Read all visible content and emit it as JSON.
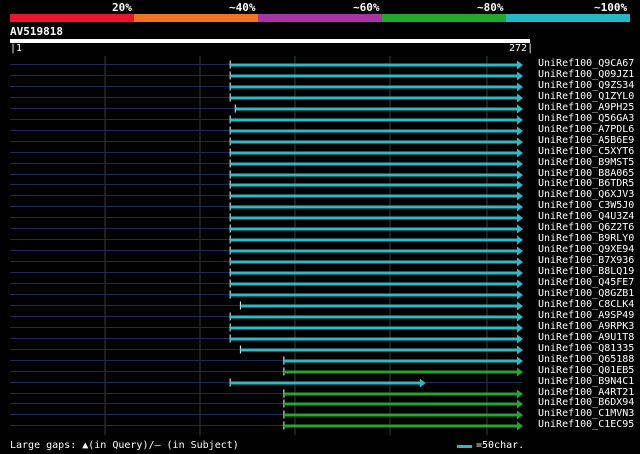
{
  "percent_labels": [
    "20%",
    "~40%",
    "~60%",
    "~80%",
    "~100%"
  ],
  "identity_colors": [
    "#e8162c",
    "#f07420",
    "#a733a4",
    "#22a62c",
    "#22b8c8"
  ],
  "query": {
    "id": "AV519818",
    "start": "1",
    "end": "272",
    "length": 272
  },
  "hits": [
    {
      "label": "UniRef100_Q9CA67",
      "start": 0.43,
      "end": 1.0,
      "color": "cyan"
    },
    {
      "label": "UniRef100_Q09JZ1",
      "start": 0.43,
      "end": 1.0,
      "color": "cyan"
    },
    {
      "label": "UniRef100_Q9ZS34",
      "start": 0.43,
      "end": 1.0,
      "color": "cyan"
    },
    {
      "label": "UniRef100_Q1ZYL0",
      "start": 0.43,
      "end": 1.0,
      "color": "cyan"
    },
    {
      "label": "UniRef100_A9PH25",
      "start": 0.44,
      "end": 1.0,
      "color": "cyan"
    },
    {
      "label": "UniRef100_Q56GA3",
      "start": 0.43,
      "end": 1.0,
      "color": "cyan"
    },
    {
      "label": "UniRef100_A7PDL6",
      "start": 0.43,
      "end": 1.0,
      "color": "cyan"
    },
    {
      "label": "UniRef100_A5B6E9",
      "start": 0.43,
      "end": 1.0,
      "color": "cyan"
    },
    {
      "label": "UniRef100_C5XYT6",
      "start": 0.43,
      "end": 1.0,
      "color": "cyan"
    },
    {
      "label": "UniRef100_B9MST5",
      "start": 0.43,
      "end": 1.0,
      "color": "cyan"
    },
    {
      "label": "UniRef100_B8A065",
      "start": 0.43,
      "end": 1.0,
      "color": "cyan"
    },
    {
      "label": "UniRef100_B6TDR5",
      "start": 0.43,
      "end": 1.0,
      "color": "cyan"
    },
    {
      "label": "UniRef100_Q6XJV3",
      "start": 0.43,
      "end": 1.0,
      "color": "cyan"
    },
    {
      "label": "UniRef100_C3W5J0",
      "start": 0.43,
      "end": 1.0,
      "color": "cyan"
    },
    {
      "label": "UniRef100_Q4U3Z4",
      "start": 0.43,
      "end": 1.0,
      "color": "cyan"
    },
    {
      "label": "UniRef100_Q6Z2T6",
      "start": 0.43,
      "end": 1.0,
      "color": "cyan"
    },
    {
      "label": "UniRef100_B9RLY0",
      "start": 0.43,
      "end": 1.0,
      "color": "cyan"
    },
    {
      "label": "UniRef100_Q9XE94",
      "start": 0.43,
      "end": 1.0,
      "color": "cyan"
    },
    {
      "label": "UniRef100_B7X936",
      "start": 0.43,
      "end": 1.0,
      "color": "cyan"
    },
    {
      "label": "UniRef100_B8LQ19",
      "start": 0.43,
      "end": 1.0,
      "color": "cyan"
    },
    {
      "label": "UniRef100_Q45FE7",
      "start": 0.43,
      "end": 1.0,
      "color": "cyan"
    },
    {
      "label": "UniRef100_Q8GZB1",
      "start": 0.43,
      "end": 1.0,
      "color": "cyan"
    },
    {
      "label": "UniRef100_C8CLK4",
      "start": 0.45,
      "end": 1.0,
      "color": "cyan"
    },
    {
      "label": "UniRef100_A9SP49",
      "start": 0.43,
      "end": 1.0,
      "color": "cyan"
    },
    {
      "label": "UniRef100_A9RPK3",
      "start": 0.43,
      "end": 1.0,
      "color": "cyan"
    },
    {
      "label": "UniRef100_A9U1T8",
      "start": 0.43,
      "end": 1.0,
      "color": "cyan"
    },
    {
      "label": "UniRef100_Q81335",
      "start": 0.45,
      "end": 1.0,
      "color": "cyan"
    },
    {
      "label": "UniRef100_Q65188",
      "start": 0.535,
      "end": 1.0,
      "color": "cyan"
    },
    {
      "label": "UniRef100_Q01EB5",
      "start": 0.535,
      "end": 1.0,
      "color": "green"
    },
    {
      "label": "UniRef100_B9N4C1",
      "start": 0.43,
      "end": 0.81,
      "color": "cyan"
    },
    {
      "label": "UniRef100_A4RT21",
      "start": 0.535,
      "end": 1.0,
      "color": "green"
    },
    {
      "label": "UniRef100_B6DX94",
      "start": 0.535,
      "end": 1.0,
      "color": "green"
    },
    {
      "label": "UniRef100_C1MVN3",
      "start": 0.535,
      "end": 1.0,
      "color": "green"
    },
    {
      "label": "UniRef100_C1EC95",
      "start": 0.535,
      "end": 1.0,
      "color": "green"
    }
  ],
  "legend": {
    "gaps_text": "Large gaps: ▲(in Query)/– (in Subject)",
    "scale_text": "=50char."
  }
}
